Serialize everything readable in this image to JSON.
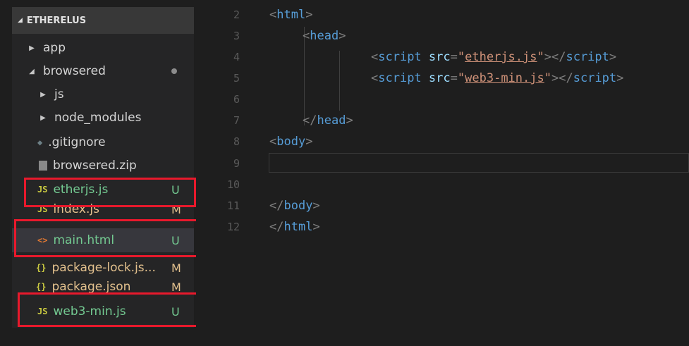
{
  "explorer": {
    "title": "ETHERELUS",
    "items": [
      {
        "label": "app",
        "kind": "folder",
        "expanded": false
      },
      {
        "label": "browsered",
        "kind": "folder",
        "expanded": true
      },
      {
        "label": "js",
        "kind": "folder",
        "expanded": false
      },
      {
        "label": "node_modules",
        "kind": "folder",
        "expanded": false
      },
      {
        "label": ".gitignore",
        "kind": "file",
        "icon": "git-icon"
      },
      {
        "label": "browsered.zip",
        "kind": "file",
        "icon": "zip-icon"
      },
      {
        "label": "etherjs.js",
        "kind": "file",
        "icon_text": "JS",
        "status": "U"
      },
      {
        "label": "index.js",
        "kind": "file",
        "icon_text": "JS",
        "status": "M"
      },
      {
        "label": "main.html",
        "kind": "file",
        "icon_text": "<>",
        "status": "U"
      },
      {
        "label": "package-lock.js...",
        "kind": "file",
        "icon_text": "{}",
        "status": "M"
      },
      {
        "label": "package.json",
        "kind": "file",
        "icon_text": "{}",
        "status": "M"
      },
      {
        "label": "web3-min.js",
        "kind": "file",
        "icon_text": "JS",
        "status": "U"
      }
    ]
  },
  "editor": {
    "line_numbers": [
      "2",
      "3",
      "4",
      "5",
      "6",
      "7",
      "8",
      "9",
      "10",
      "11",
      "12"
    ],
    "lines": {
      "l2": {
        "tag": "html"
      },
      "l3": {
        "tag": "head"
      },
      "l4": {
        "tag": "script",
        "attr": "src",
        "value": "etherjs.js",
        "close": "script"
      },
      "l5": {
        "tag": "script",
        "attr": "src",
        "value": "web3-min.js",
        "close": "script"
      },
      "l7": {
        "close": "head"
      },
      "l8": {
        "tag": "body"
      },
      "l11": {
        "close": "body"
      },
      "l12": {
        "close": "html"
      }
    }
  },
  "colors": {
    "highlight": "#e8192c",
    "untracked": "#73c991",
    "modified": "#e2c08d"
  }
}
